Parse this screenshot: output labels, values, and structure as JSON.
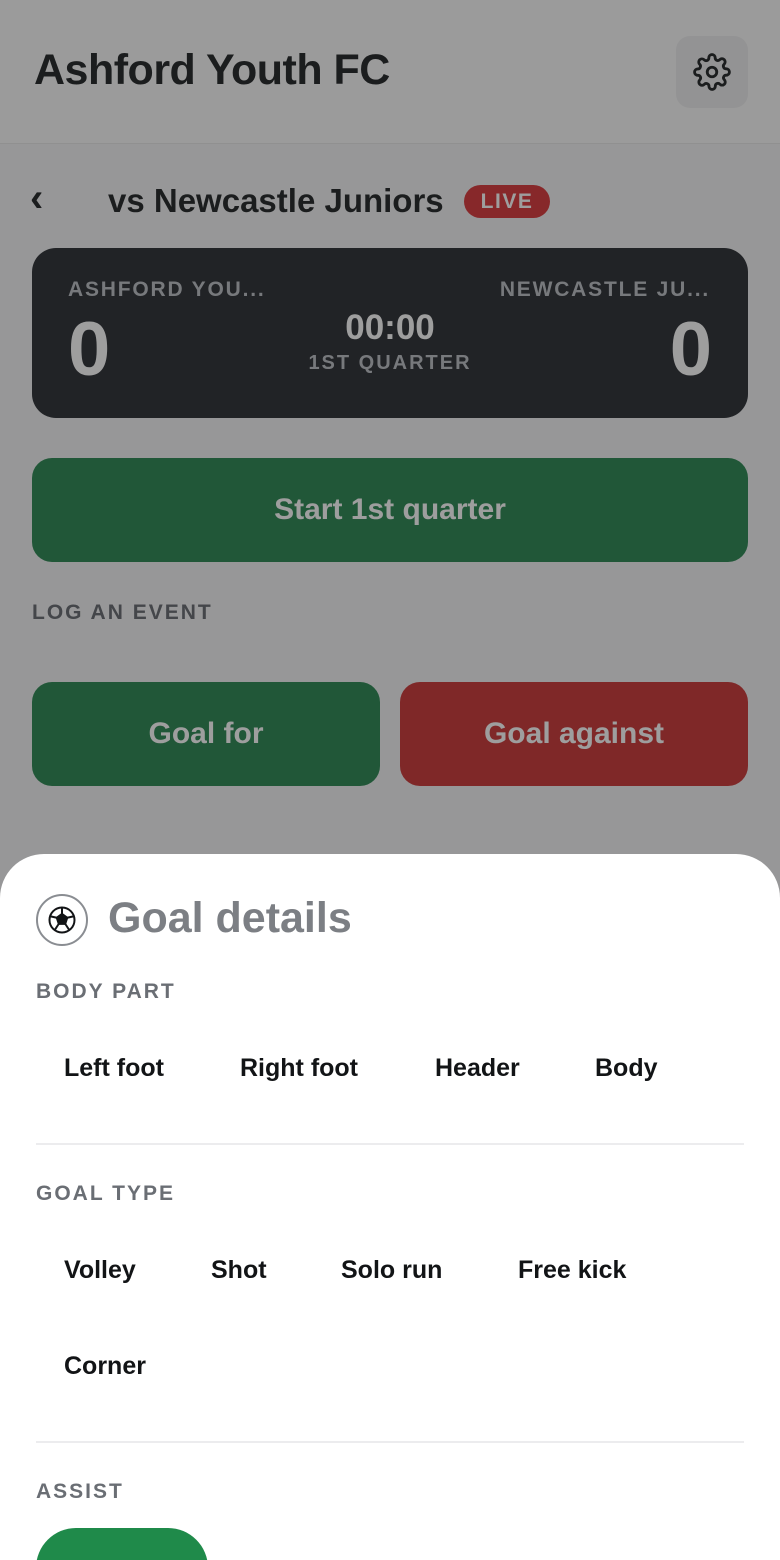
{
  "app": {
    "title": "Ashford Youth FC"
  },
  "match": {
    "back_symbol": "‹",
    "title": "vs Newcastle Juniors",
    "status": "LIVE",
    "home_team": "ASHFORD YOU...",
    "away_team": "NEWCASTLE JU...",
    "home_score": "0",
    "away_score": "0",
    "clock": "00:00",
    "period": "1ST QUARTER"
  },
  "actions": {
    "start": "Start 1st quarter",
    "log_label": "LOG AN EVENT",
    "goal_for": "Goal for",
    "goal_against": "Goal against"
  },
  "sheet": {
    "title": "Goal details",
    "body_part_label": "BODY PART",
    "body_parts": [
      "Left foot",
      "Right foot",
      "Header",
      "Body"
    ],
    "goal_type_label": "GOAL TYPE",
    "goal_types": [
      "Volley",
      "Shot",
      "Solo run",
      "Free kick",
      "Corner"
    ],
    "assist_label": "ASSIST"
  },
  "colors": {
    "green": "#1c7e45",
    "red": "#c62828",
    "live": "#d6282d",
    "scoreboard": "#1c1f25"
  },
  "icons": [
    "gear-icon",
    "back-chevron-icon",
    "soccer-ball-icon"
  ]
}
